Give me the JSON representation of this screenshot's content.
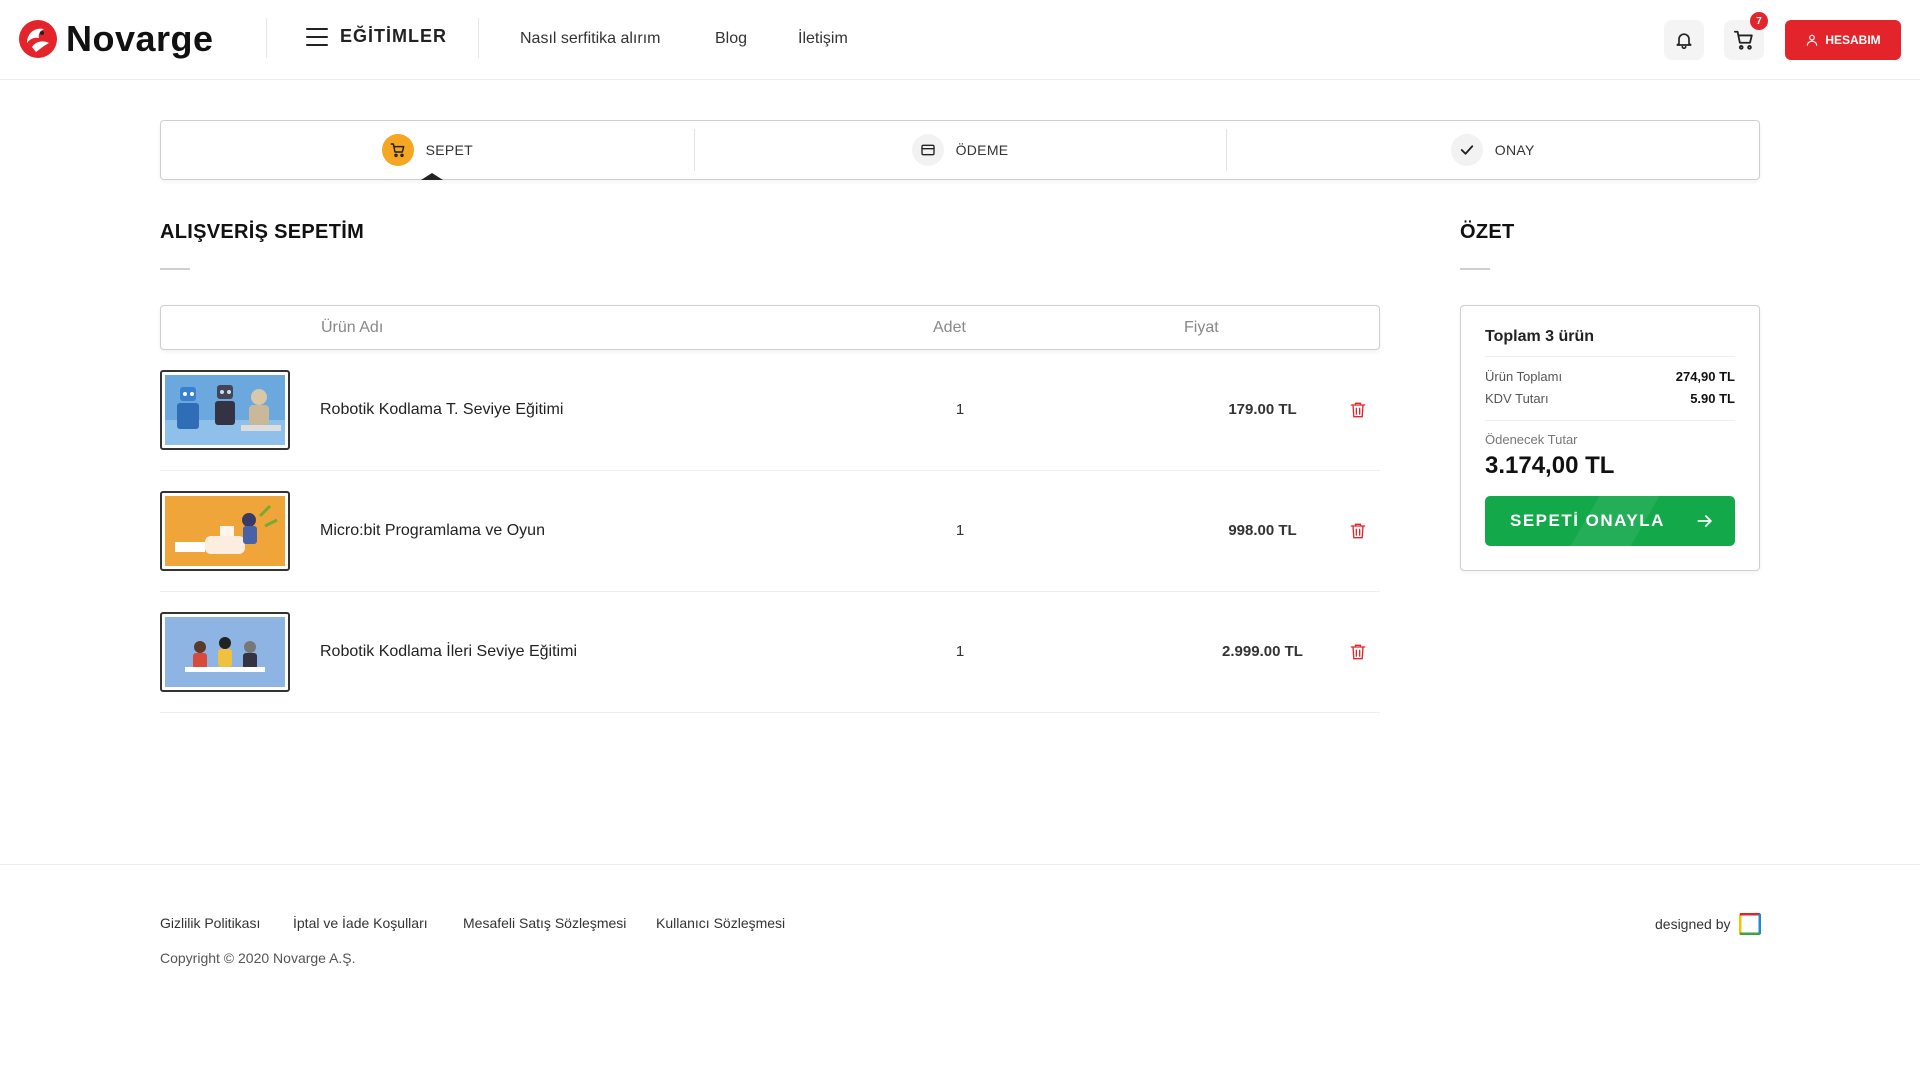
{
  "header": {
    "brand": "Novarge",
    "menu_label": "EĞİTİMLER",
    "nav": [
      "Nasıl serfitika alırım",
      "Blog",
      "İletişim"
    ],
    "cart_count": "7",
    "account_label": "HESABIM",
    "brand_color": "#e3242b"
  },
  "stepper": {
    "steps": [
      {
        "label": "SEPET",
        "icon": "cart-icon",
        "active": true
      },
      {
        "label": "ÖDEME",
        "icon": "credit-card-icon",
        "active": false
      },
      {
        "label": "ONAY",
        "icon": "check-icon",
        "active": false
      }
    ],
    "active_color": "#f5a623"
  },
  "cart": {
    "title": "ALIŞVERİŞ SEPETİM",
    "columns": {
      "name": "Ürün Adı",
      "qty": "Adet",
      "price": "Fiyat"
    },
    "items": [
      {
        "name": "Robotik Kodlama T. Seviye Eğitimi",
        "qty": "1",
        "price": "179.00 TL"
      },
      {
        "name": "Micro:bit Programlama ve Oyun",
        "qty": "1",
        "price": "998.00 TL"
      },
      {
        "name": "Robotik Kodlama İleri Seviye Eğitimi",
        "qty": "1",
        "price": "2.999.00 TL"
      }
    ]
  },
  "summary": {
    "title": "ÖZET",
    "total_items": "Toplam 3 ürün",
    "product_total_label": "Ürün Toplamı",
    "product_total_value": "274,90 TL",
    "vat_label": "KDV Tutarı",
    "vat_value": "5.90 TL",
    "payable_label": "Ödenecek Tutar",
    "payable_value": "3.174,00 TL",
    "confirm_label": "SEPETİ ONAYLA",
    "confirm_color": "#13a84a"
  },
  "footer": {
    "links": [
      "Gizlilik Politikası",
      "İptal ve İade Koşulları",
      "Mesafeli Satış Sözleşmesi",
      "Kullanıcı Sözleşmesi"
    ],
    "copyright": "Copyright © 2020 Novarge A.Ş.",
    "designed_by": "designed by"
  }
}
